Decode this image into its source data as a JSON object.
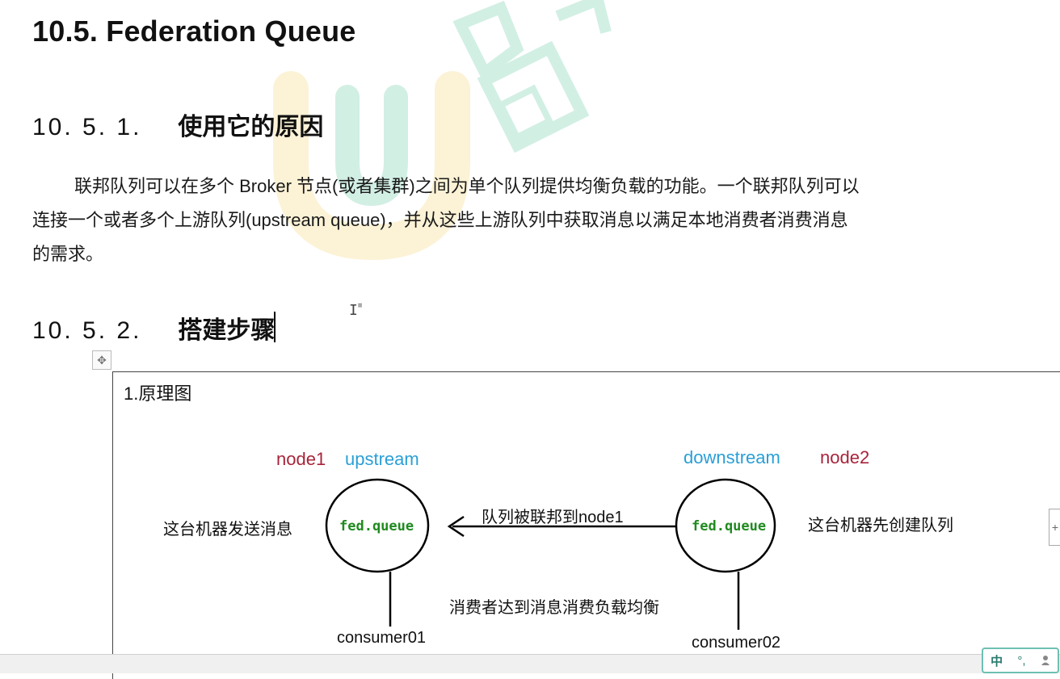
{
  "heading_main": "10.5. Federation Queue",
  "section1": {
    "number": "10. 5. 1.",
    "title": "使用它的原因"
  },
  "paragraph": {
    "line1": "联邦队列可以在多个 Broker 节点(或者集群)之间为单个队列提供均衡负载的功能。一个联邦队列可以",
    "line2": "连接一个或者多个上游队列(upstream queue)，并从这些上游队列中获取消息以满足本地消费者消费消息",
    "line3": "的需求。"
  },
  "section2": {
    "number": "10. 5. 2.",
    "title": "搭建步骤"
  },
  "cursor_glyph": "I",
  "move_handle_icon": "✥",
  "diagram": {
    "title": "1.原理图",
    "left_node": {
      "name": "node1",
      "role": "upstream",
      "queue": "fed.queue",
      "note": "这台机器发送消息",
      "consumer": "consumer01"
    },
    "right_node": {
      "name": "node2",
      "role": "downstream",
      "queue": "fed.queue",
      "note": "这台机器先创建队列",
      "consumer": "consumer02"
    },
    "arrow_label": "队列被联邦到node1",
    "balance_label": "消费者达到消息消费负载均衡"
  },
  "colors": {
    "node_red": "#a8243a",
    "role_blue": "#2a9fd6",
    "queue_green": "#1f8a1f"
  },
  "ime": {
    "lang": "中",
    "punct": "°,",
    "user_icon": "person-icon"
  },
  "side_tab": "+"
}
